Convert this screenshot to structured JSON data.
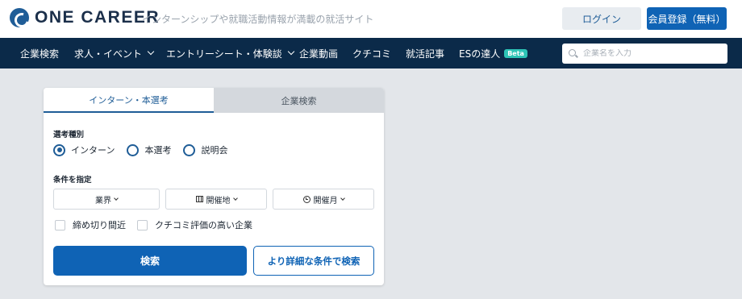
{
  "header": {
    "logo_text": "ONE CAREER",
    "tagline": "インターンシップや就職活動情報が満載の就活サイト",
    "login_label": "ログイン",
    "register_label": "会員登録（無料）"
  },
  "nav": {
    "items": [
      {
        "label": "企業検索"
      },
      {
        "label": "求人・イベント"
      },
      {
        "label": "エントリーシート・体験談"
      },
      {
        "label": "企業動画"
      },
      {
        "label": "クチコミ"
      },
      {
        "label": "就活記事"
      },
      {
        "label": "ESの達人",
        "badge": "Beta"
      }
    ],
    "search_placeholder": "企業名を入力"
  },
  "search_card": {
    "tabs": [
      {
        "label": "インターン・本選考",
        "active": true
      },
      {
        "label": "企業検索",
        "active": false
      }
    ],
    "type_label": "選考種別",
    "radios": [
      {
        "label": "インターン",
        "checked": true
      },
      {
        "label": "本選考",
        "checked": false
      },
      {
        "label": "説明会",
        "checked": false
      }
    ],
    "condition_label": "条件を指定",
    "selects": [
      {
        "label": "業界",
        "icon": "none"
      },
      {
        "label": "開催地",
        "icon": "map-icon"
      },
      {
        "label": "開催月",
        "icon": "clock-icon"
      }
    ],
    "checkboxes": [
      {
        "label": "締め切り間近",
        "checked": false
      },
      {
        "label": "クチコミ評価の高い企業",
        "checked": false
      }
    ],
    "search_button": "検索",
    "detail_button": "より詳細な条件で検索"
  },
  "colors": {
    "primary": "#0f63b5",
    "nav_bg": "#0b2a49",
    "page_bg": "#e3e6ea",
    "beta_badge": "#2ec4b6"
  }
}
